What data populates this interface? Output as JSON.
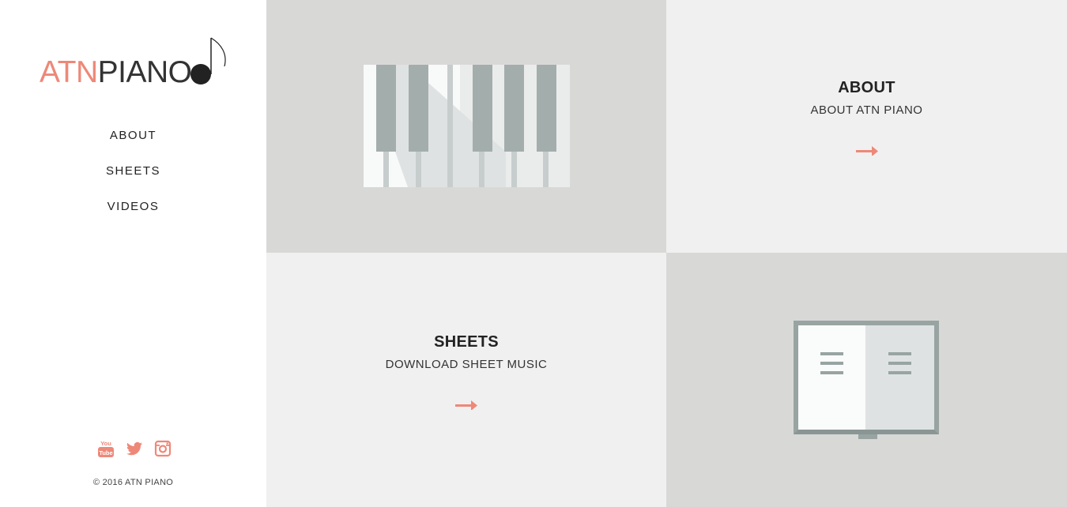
{
  "brand": {
    "part1": "ATN",
    "part2": "PIANO"
  },
  "nav": [
    {
      "label": "ABOUT"
    },
    {
      "label": "SHEETS"
    },
    {
      "label": "VIDEOS"
    }
  ],
  "social": [
    "youtube-icon",
    "twitter-icon",
    "instagram-icon"
  ],
  "footer": {
    "copyright": "© 2016 ATN PIANO"
  },
  "tiles": {
    "about": {
      "title": "ABOUT",
      "subtitle": "ABOUT ATN PIANO",
      "arrow_icon": "arrow-right-icon"
    },
    "sheets": {
      "title": "SHEETS",
      "subtitle": "DOWNLOAD SHEET MUSIC",
      "arrow_icon": "arrow-right-icon"
    },
    "piano_illustration": "piano-keys-icon",
    "book_illustration": "open-book-icon"
  },
  "colors": {
    "accent": "#ee8878",
    "tile_dark": "#d8d9d7",
    "tile_light": "#f0f0f0",
    "text": "#222222"
  }
}
